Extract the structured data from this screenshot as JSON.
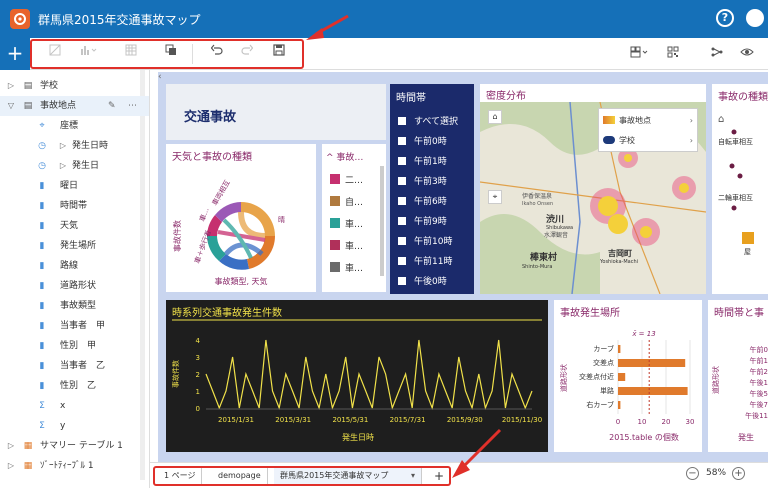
{
  "app": {
    "title": "群馬県2015年交通事故マップ",
    "help": "?"
  },
  "toolbar": {
    "add": "+"
  },
  "sidebar": {
    "items": [
      {
        "label": "学校",
        "level": 0,
        "twisty": "▷",
        "icon": "table-icon"
      },
      {
        "label": "事故地点",
        "level": 0,
        "twisty": "▽",
        "icon": "table-icon",
        "selected": true
      },
      {
        "label": "座標",
        "level": 1,
        "icon": "location-icon"
      },
      {
        "label": "発生日時",
        "level": 1,
        "icon": "clock-icon",
        "twisty": "▷"
      },
      {
        "label": "発生日",
        "level": 1,
        "icon": "clock-icon",
        "twisty": "▷"
      },
      {
        "label": "曜日",
        "level": 1,
        "icon": "bar-icon"
      },
      {
        "label": "時間帯",
        "level": 1,
        "icon": "bar-icon"
      },
      {
        "label": "天気",
        "level": 1,
        "icon": "bar-icon"
      },
      {
        "label": "発生場所",
        "level": 1,
        "icon": "bar-icon"
      },
      {
        "label": "路線",
        "level": 1,
        "icon": "bar-icon"
      },
      {
        "label": "道路形状",
        "level": 1,
        "icon": "bar-icon"
      },
      {
        "label": "事故類型",
        "level": 1,
        "icon": "bar-icon"
      },
      {
        "label": "当事者　甲",
        "level": 1,
        "icon": "bar-icon"
      },
      {
        "label": "性別　甲",
        "level": 1,
        "icon": "bar-icon"
      },
      {
        "label": "当事者　乙",
        "level": 1,
        "icon": "bar-icon"
      },
      {
        "label": "性別　乙",
        "level": 1,
        "icon": "bar-icon"
      },
      {
        "label": "x",
        "level": 1,
        "icon": "sigma-icon"
      },
      {
        "label": "y",
        "level": 1,
        "icon": "sigma-icon"
      },
      {
        "label": "サマリー テーブル 1",
        "level": 0,
        "twisty": "▷",
        "icon": "table-orange-icon"
      },
      {
        "label": "ｿﾞｰﾄﾃｨｰﾌﾞﾙ 1",
        "level": 0,
        "twisty": "▷",
        "icon": "table-orange-icon"
      }
    ]
  },
  "dashboard": {
    "title_panel": {
      "label": "交通事故"
    },
    "weather_panel": {
      "title": "天気と事故の種類",
      "ylabel": "事故件数",
      "xlabel": "事故類型, 天気",
      "labels": [
        "車両相互",
        "車…",
        "車＋歩行者",
        "晴"
      ]
    },
    "legend_panel": {
      "title": "事故…",
      "toggle": "^",
      "items": [
        {
          "label": "二…",
          "color": "#c6306f"
        },
        {
          "label": "自…",
          "color": "#b07a3e"
        },
        {
          "label": "車…",
          "color": "#2aa198"
        },
        {
          "label": "車…",
          "color": "#b0305a"
        },
        {
          "label": "車…",
          "color": "#6b6b6b"
        }
      ]
    },
    "time_panel": {
      "title": "時間帯",
      "items": [
        "すべて選択",
        "午前0時",
        "午前1時",
        "午前3時",
        "午前6時",
        "午前9時",
        "午前10時",
        "午前11時",
        "午後0時"
      ]
    },
    "density_panel": {
      "title": "密度分布",
      "layers": [
        "事故地点",
        "学校"
      ],
      "places": [
        "渋川",
        "Shibukawa",
        "水澤観音",
        "伊香保温泉",
        "棒東村",
        "吉岡町",
        "Yoshioka-Machi",
        "Shinto-Mura",
        "Ikaho Onsen"
      ]
    },
    "kind_panel": {
      "title": "事故の種類",
      "labels": [
        "自転車相互",
        "二輪車相互",
        "屋"
      ]
    },
    "timeseries_panel": {
      "title": "時系列交通事故発生件数",
      "ylabel": "事故件数",
      "xlabel": "発生日時",
      "xticks": [
        "2015/1/31",
        "2015/3/31",
        "2015/5/31",
        "2015/7/31",
        "2015/9/30",
        "2015/11/30"
      ]
    },
    "place_panel": {
      "title": "事故発生場所",
      "ylabel": "道路形状",
      "xlabel": "2015.table の個数",
      "mean_label": "x̄ = 13"
    },
    "hour_panel": {
      "title": "時間帯と事",
      "labels": [
        "午前0",
        "午前1",
        "午前2",
        "午後1",
        "午後5",
        "午後7",
        "午後11"
      ],
      "xlabel": "発生"
    }
  },
  "chart_data": [
    {
      "type": "line",
      "title": "時系列交通事故発生件数",
      "xlabel": "発生日時",
      "ylabel": "事故件数",
      "ylim": [
        0,
        4
      ],
      "yticks": [
        0,
        1,
        2,
        3,
        4
      ],
      "x_tick_labels": [
        "2015/1/31",
        "2015/3/31",
        "2015/5/31",
        "2015/7/31",
        "2015/9/30",
        "2015/11/30"
      ],
      "series": [
        {
          "values": [
            2,
            1,
            0,
            1,
            3,
            0,
            2,
            1,
            0,
            4,
            1,
            0,
            2,
            1,
            0,
            3,
            1,
            0,
            2,
            0,
            1,
            3,
            0,
            2,
            1,
            0,
            3,
            2,
            0,
            1,
            2,
            0,
            4,
            1,
            0,
            2,
            1,
            0,
            3,
            1,
            0,
            2,
            0,
            1,
            4,
            0,
            2,
            1,
            0,
            1
          ]
        }
      ],
      "color": "#f0e14a"
    },
    {
      "type": "bar",
      "title": "事故発生場所",
      "xlabel": "2015.table の個数",
      "ylabel": "道路形状",
      "categories": [
        "カーブ",
        "交差点",
        "交差点付近",
        "単路",
        "右カーブ"
      ],
      "values": [
        1,
        28,
        3,
        29,
        1
      ],
      "xlim": [
        0,
        30
      ],
      "xticks": [
        0,
        10,
        20,
        30
      ],
      "mean": 13,
      "color": "#e07a2c"
    }
  ],
  "tabs": {
    "items": [
      "1 ページ",
      "demopage",
      "群馬県2015年交通事故マップ"
    ],
    "add": "+",
    "dropdown": "▾"
  },
  "zoom": {
    "level": "58%",
    "minus": "−",
    "plus": "+"
  }
}
